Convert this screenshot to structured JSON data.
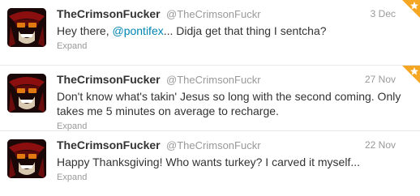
{
  "tweets": [
    {
      "fullname": "TheCrimsonFucker",
      "username": "@TheCrimsonFuckr",
      "time": "3 Dec",
      "text_before": "Hey there, ",
      "mention": "@pontifex",
      "text_after": "... Didja get that thing I sentcha?",
      "expand": "Expand",
      "favorited": true
    },
    {
      "fullname": "TheCrimsonFucker",
      "username": "@TheCrimsonFuckr",
      "time": "27 Nov",
      "text": "Don't know what's takin' Jesus so long with the second coming. Only takes me 5 minutes on average to recharge.",
      "expand": "Expand",
      "favorited": true
    },
    {
      "fullname": "TheCrimsonFucker",
      "username": "@TheCrimsonFuckr",
      "time": "22 Nov",
      "text": "Happy Thanksgiving! Who wants turkey? I carved it myself...",
      "expand": "Expand",
      "favorited": false
    }
  ],
  "colors": {
    "link": "#0084b4",
    "muted": "#999999",
    "text": "#333333",
    "favorite_badge": "#f5a623"
  }
}
